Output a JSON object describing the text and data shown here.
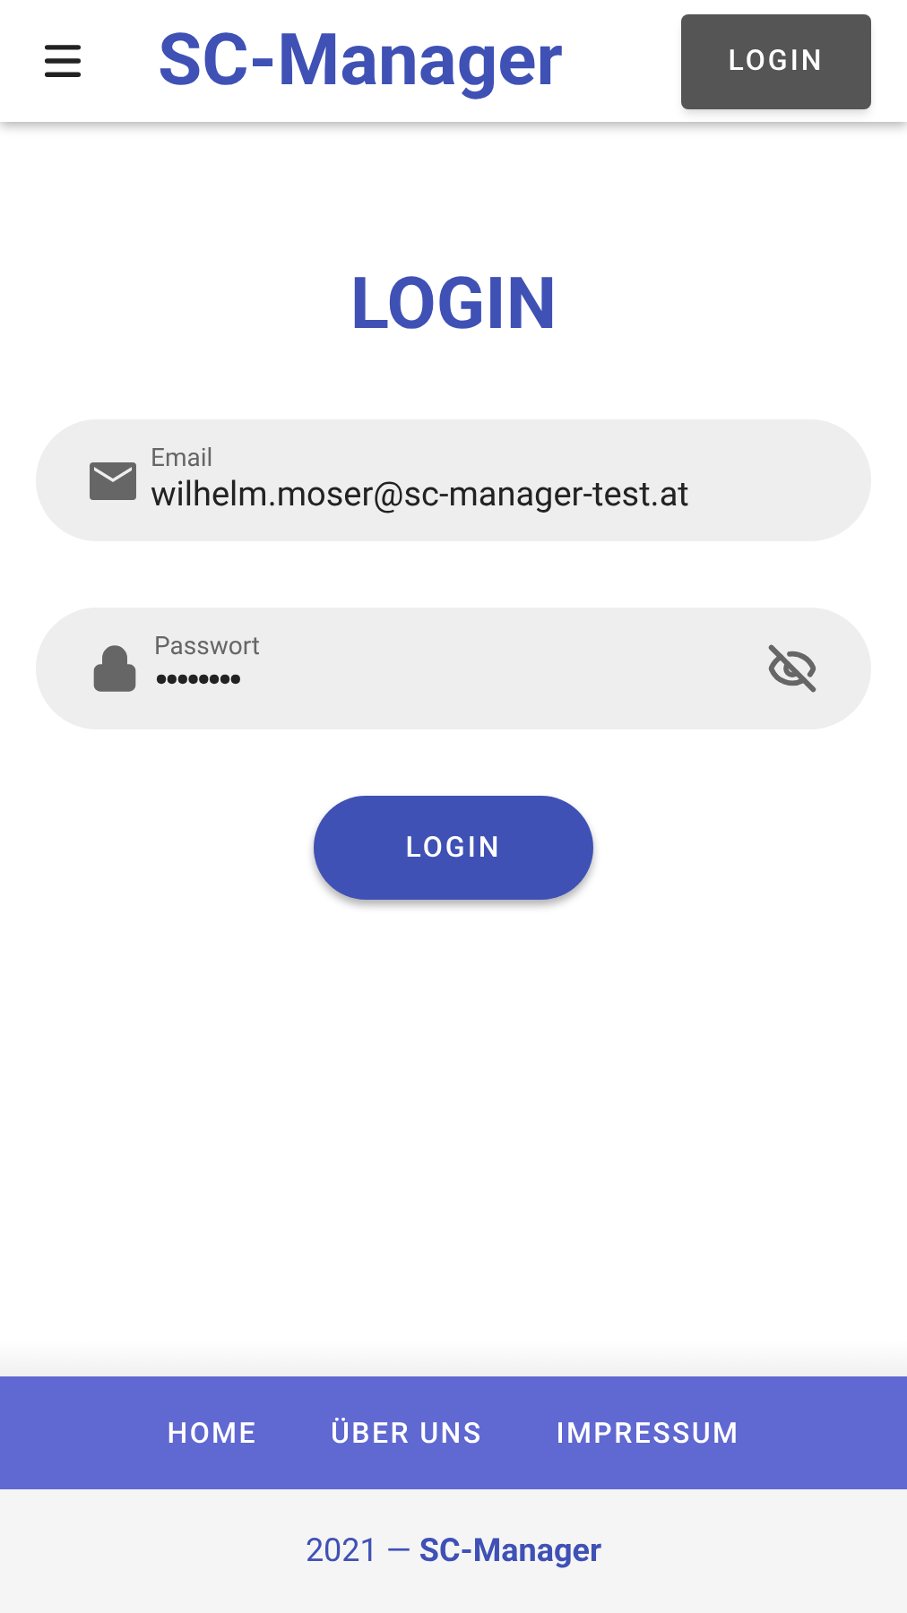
{
  "header": {
    "app_title": "SC-Manager",
    "login_button": "LOGIN"
  },
  "login": {
    "heading": "LOGIN",
    "email": {
      "label": "Email",
      "value": "wilhelm.moser@sc-manager-test.at"
    },
    "password": {
      "label": "Passwort",
      "value": "••••••••",
      "show_password": false
    },
    "submit": "LOGIN"
  },
  "footer": {
    "links": [
      "HOME",
      "ÜBER UNS",
      "IMPRESSUM"
    ],
    "copyright": "2021 — **SC-Manager**"
  }
}
